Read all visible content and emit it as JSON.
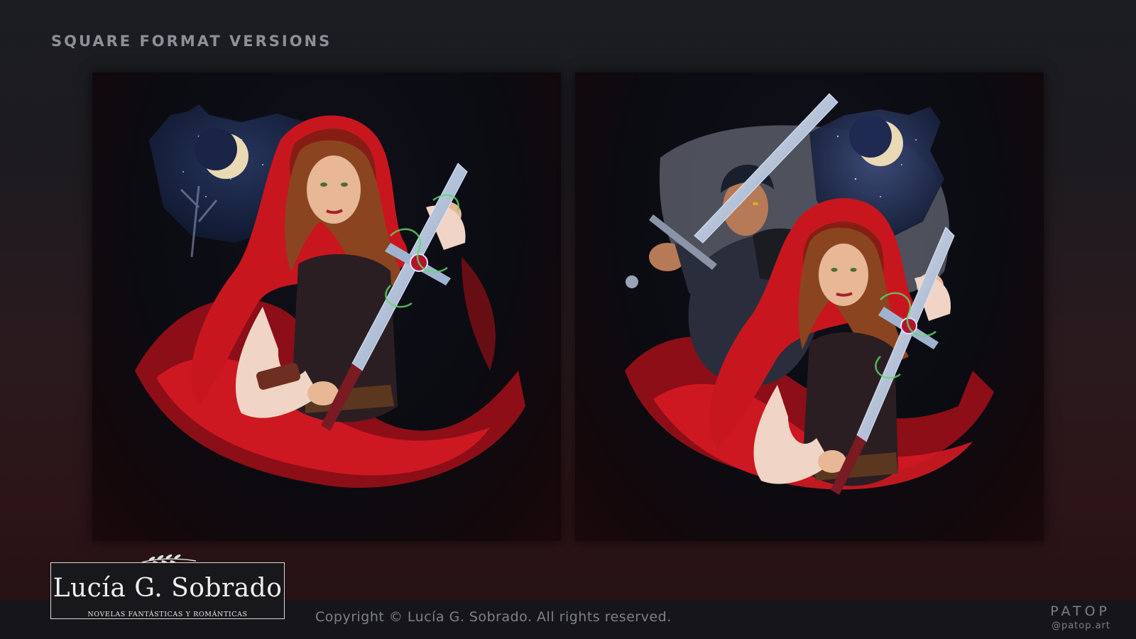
{
  "section_title": "SQUARE FORMAT VERSIONS",
  "artworks": [
    {
      "subject": "Red hooded heroine holding a jeweled sword before a crescent moon and a howling wolf silhouette"
    },
    {
      "subject": "Dark-haired swordsman and red hooded heroine with jeweled sword before a crescent moon and howling wolf silhouette"
    }
  ],
  "logo": {
    "name": "Lucía G. Sobrado",
    "tagline": "NOVELAS FANTÁSTICAS Y ROMÁNTICAS"
  },
  "copyright": "Copyright © Lucía G. Sobrado. All rights reserved.",
  "brand": {
    "name": "PATOP",
    "handle": "@patop.art"
  },
  "colors": {
    "cape_red": "#c8161f",
    "moon": "#e9d9b4",
    "sword": "#aebfd4",
    "glow_green": "#5fdc6a"
  }
}
